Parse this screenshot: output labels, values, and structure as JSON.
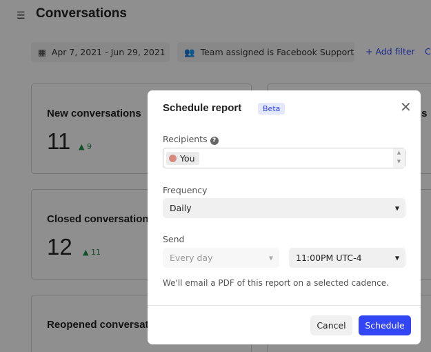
{
  "header": {
    "title": "Conversations",
    "menu_icon": "hamburger-icon"
  },
  "filters": {
    "date_range": "Apr 7, 2021 - Jun 29, 2021",
    "team_filter": "Team assigned is Facebook Support",
    "add_filter": "+ Add filter",
    "cut_off": "C"
  },
  "cards": [
    {
      "label": "New conversations",
      "value": "11",
      "delta": "9"
    },
    {
      "label": "Closed conversations",
      "value": "12",
      "delta": "11"
    },
    {
      "label": "Reopened conversations"
    }
  ],
  "right_card_fragment": "ns",
  "modal": {
    "title": "Schedule report",
    "badge": "Beta",
    "recipients_label": "Recipients",
    "recipient": "You",
    "frequency_label": "Frequency",
    "frequency_value": "Daily",
    "send_label": "Send",
    "send_day": "Every day",
    "send_time": "11:00PM UTC-4",
    "note": "We'll email a PDF of this report on a selected cadence.",
    "cancel": "Cancel",
    "schedule": "Schedule"
  },
  "colors": {
    "accent": "#3346f5",
    "positive": "#1e8a4a"
  }
}
